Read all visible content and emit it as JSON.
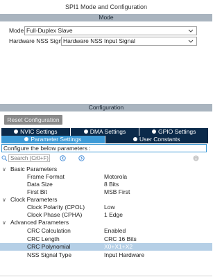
{
  "window": {
    "title": "SPI1 Mode and Configuration"
  },
  "mode_section": {
    "header": "Mode",
    "mode_label": "Mode",
    "mode_value": "Full-Duplex Slave",
    "nss_label": "Hardware NSS Signal",
    "nss_value": "Hardware NSS Input Signal"
  },
  "config_section": {
    "header": "Configuration",
    "reset_button": "Reset Configuration"
  },
  "tabs_top": [
    {
      "label": "NVIC Settings",
      "icon": "check-circle-icon"
    },
    {
      "label": "DMA Settings",
      "icon": "check-circle-icon"
    },
    {
      "label": "GPIO Settings",
      "icon": "check-circle-icon"
    }
  ],
  "tabs_bottom": [
    {
      "label": "Parameter Settings",
      "icon": "check-circle-icon",
      "active": true
    },
    {
      "label": "User Constants",
      "icon": "check-circle-icon",
      "active": false
    }
  ],
  "hint": "Configure the below parameters :",
  "search": {
    "placeholder": "Search (Crtl+F)"
  },
  "groups": [
    {
      "name": "Basic Parameters",
      "params": [
        {
          "name": "Frame Format",
          "value": "Motorola"
        },
        {
          "name": "Data Size",
          "value": "8 Bits"
        },
        {
          "name": "First Bit",
          "value": "MSB First"
        }
      ]
    },
    {
      "name": "Clock Parameters",
      "params": [
        {
          "name": "Clock Polarity (CPOL)",
          "value": "Low"
        },
        {
          "name": "Clock Phase (CPHA)",
          "value": "1 Edge"
        }
      ]
    },
    {
      "name": "Advanced Parameters",
      "params": [
        {
          "name": "CRC Calculation",
          "value": "Enabled"
        },
        {
          "name": "CRC Length",
          "value": "CRC 16 Bits"
        },
        {
          "name": "CRC Polynomial",
          "value": "X0+X1+X2"
        },
        {
          "name": "NSS Signal Type",
          "value": "Input Hardware"
        }
      ]
    }
  ],
  "colors": {
    "section_header": "#a9b4bf",
    "tab_dark": "#0b2a4a",
    "tab_active": "#3d9ad6",
    "selected_row": "#b5cfe6"
  }
}
